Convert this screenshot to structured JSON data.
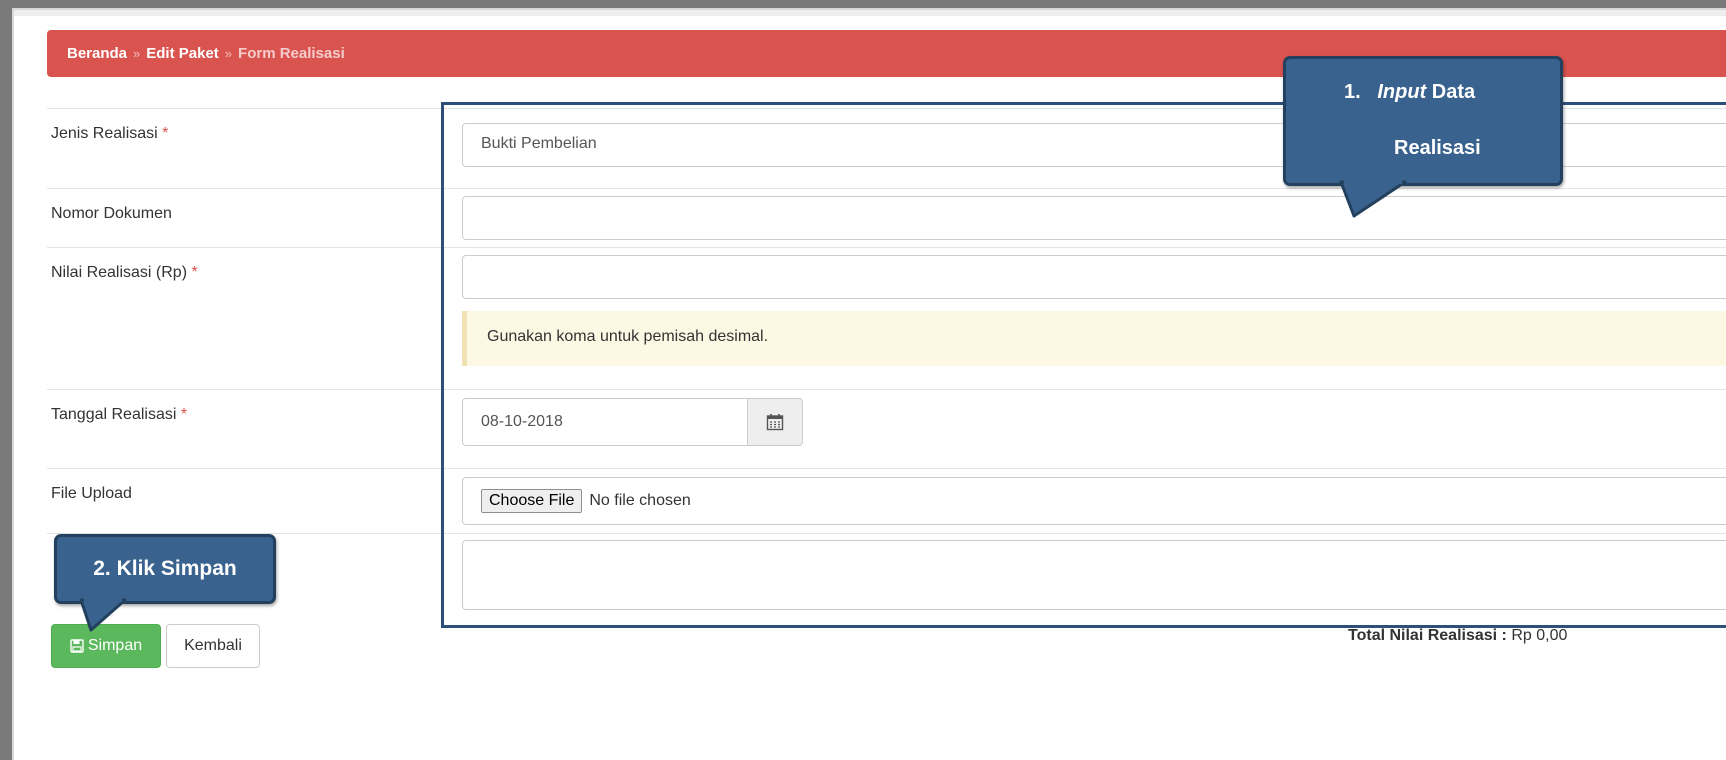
{
  "breadcrumb": {
    "items": [
      "Beranda",
      "Edit Paket",
      "Form Realisasi"
    ],
    "separator": "»"
  },
  "form": {
    "jenis_realisasi": {
      "label": "Jenis Realisasi",
      "required_mark": "*",
      "value": "Bukti Pembelian"
    },
    "nomor_dokumen": {
      "label": "Nomor Dokumen",
      "value": ""
    },
    "nilai_realisasi": {
      "label": "Nilai Realisasi (Rp)",
      "required_mark": "*",
      "value": "",
      "help": "Gunakan koma untuk pemisah desimal."
    },
    "tanggal_realisasi": {
      "label": "Tanggal Realisasi",
      "required_mark": "*",
      "value": "08-10-2018",
      "icon": "calendar-icon"
    },
    "file_upload": {
      "label": "File Upload",
      "button": "Choose File",
      "status": "No file chosen"
    },
    "keterangan": {
      "value": ""
    }
  },
  "actions": {
    "save_label": "Simpan",
    "save_icon": "floppy-disk-icon",
    "back_label": "Kembali"
  },
  "total": {
    "label": "Total Nilai Realisasi :",
    "value": "Rp 0,00"
  },
  "callouts": {
    "step1_number": "1.",
    "step1_italic": "Input",
    "step1_rest": "Data",
    "step1_line2": "Realisasi",
    "step2": "2. Klik Simpan"
  },
  "colors": {
    "breadcrumb_bg": "#d9534f",
    "save_button": "#5cb85c",
    "callout_bg": "#3a628e",
    "highlight_border": "#2e4f7a",
    "help_bg": "#fcf8e3"
  }
}
